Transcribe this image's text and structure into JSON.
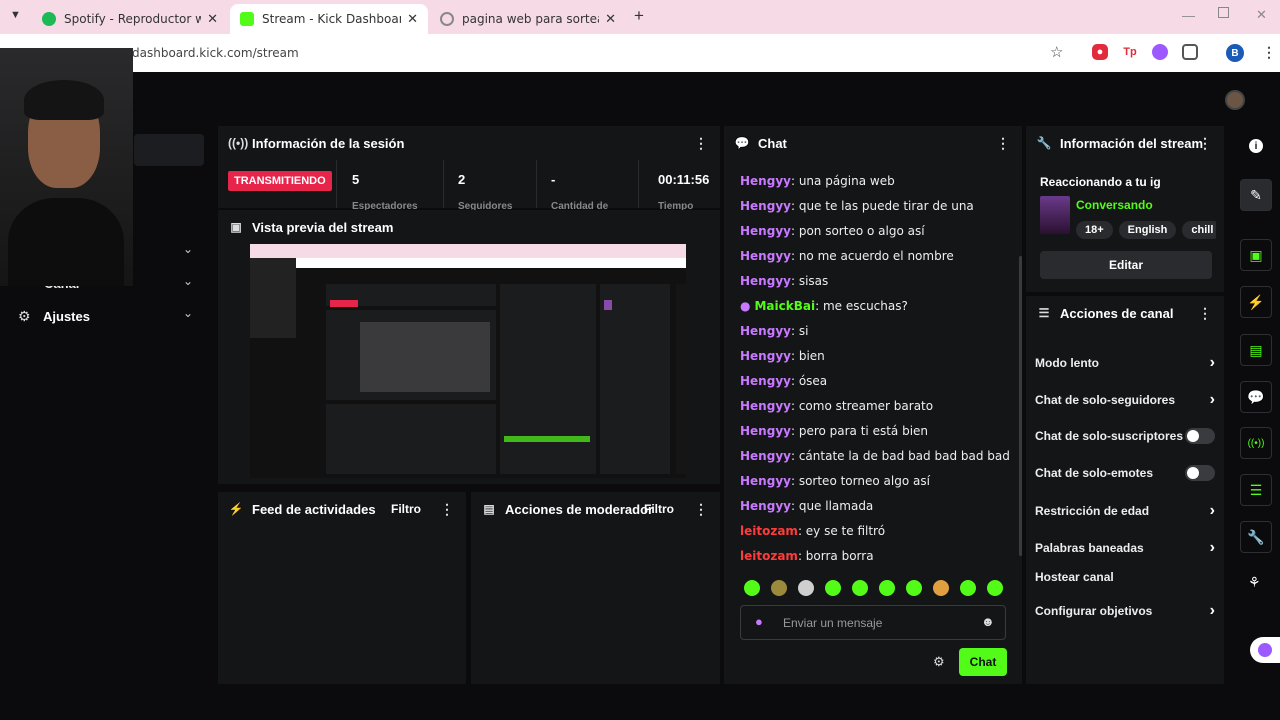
{
  "browser": {
    "tabs": [
      {
        "title": "Spotify - Reproductor web: mú",
        "favicon_color": "#1db954"
      },
      {
        "title": "Stream - Kick Dashboard",
        "favicon_color": "#53fc18"
      },
      {
        "title": "pagina web para sortear encue",
        "favicon_color": "#888888"
      }
    ],
    "url": "dashboard.kick.com/stream",
    "profile_initial": "B"
  },
  "sidebar": {
    "partial_item": "Canal",
    "settings_label": "Ajustes"
  },
  "session": {
    "title": "Información de la sesión",
    "status": "TRANSMITIENDO",
    "stats": [
      {
        "value": "5",
        "label": "Espectadores"
      },
      {
        "value": "2",
        "label": "Seguidores"
      },
      {
        "value": "-",
        "label": "Cantidad de"
      },
      {
        "value": "00:11:56",
        "label": "Tiempo"
      }
    ]
  },
  "preview": {
    "title": "Vista previa del stream"
  },
  "activity": {
    "title": "Feed de actividades",
    "filter": "Filtro"
  },
  "modactions": {
    "title": "Acciones de moderador",
    "filter": "Filtro"
  },
  "chat": {
    "title": "Chat",
    "messages": [
      {
        "user": "Hengyy",
        "text": "una página web",
        "color": "p"
      },
      {
        "user": "Hengyy",
        "text": "que te las puede tirar de una",
        "color": "p"
      },
      {
        "user": "Hengyy",
        "text": "pon sorteo o algo así",
        "color": "p"
      },
      {
        "user": "Hengyy",
        "text": "no me acuerdo el nombre",
        "color": "p"
      },
      {
        "user": "Hengyy",
        "text": "sisas",
        "color": "p"
      },
      {
        "user": "MaickBai",
        "text": "me escuchas?",
        "color": "g"
      },
      {
        "user": "Hengyy",
        "text": "si",
        "color": "p"
      },
      {
        "user": "Hengyy",
        "text": "bien",
        "color": "p"
      },
      {
        "user": "Hengyy",
        "text": "ósea",
        "color": "p"
      },
      {
        "user": "Hengyy",
        "text": "como streamer barato",
        "color": "p"
      },
      {
        "user": "Hengyy",
        "text": "pero para ti está bien",
        "color": "p"
      },
      {
        "user": "Hengyy",
        "text": "cántate la de bad bad bad bad bad",
        "color": "p"
      },
      {
        "user": "Hengyy",
        "text": "sorteo torneo algo así",
        "color": "p"
      },
      {
        "user": "Hengyy",
        "text": "que llamada",
        "color": "p"
      },
      {
        "user": "leitozam",
        "text": "ey se te filtró",
        "color": "r"
      },
      {
        "user": "leitozam",
        "text": "borra borra",
        "color": "r"
      }
    ],
    "input_placeholder": "Enviar un mensaje",
    "send_label": "Chat"
  },
  "stream_info": {
    "title": "Información del stream",
    "stream_title": "Reaccionando a tu ig",
    "category": "Conversando",
    "tags": [
      "18+",
      "English",
      "chill"
    ],
    "edit_label": "Editar"
  },
  "channel_actions": {
    "title": "Acciones de canal",
    "items": [
      {
        "label": "Modo lento",
        "kind": "chevron"
      },
      {
        "label": "Chat de solo-seguidores",
        "kind": "chevron"
      },
      {
        "label": "Chat de solo-suscriptores",
        "kind": "toggle"
      },
      {
        "label": "Chat de solo-emotes",
        "kind": "toggle"
      },
      {
        "label": "Restricción de edad",
        "kind": "chevron"
      },
      {
        "label": "Palabras baneadas",
        "kind": "chevron"
      },
      {
        "label": "Hostear canal",
        "kind": "none"
      },
      {
        "label": "Configurar objetivos",
        "kind": "chevron"
      }
    ]
  },
  "colors": {
    "accent": "#53fc18",
    "live": "#e7254a",
    "username_purple": "#c879ff",
    "username_red": "#ff3b3b"
  }
}
